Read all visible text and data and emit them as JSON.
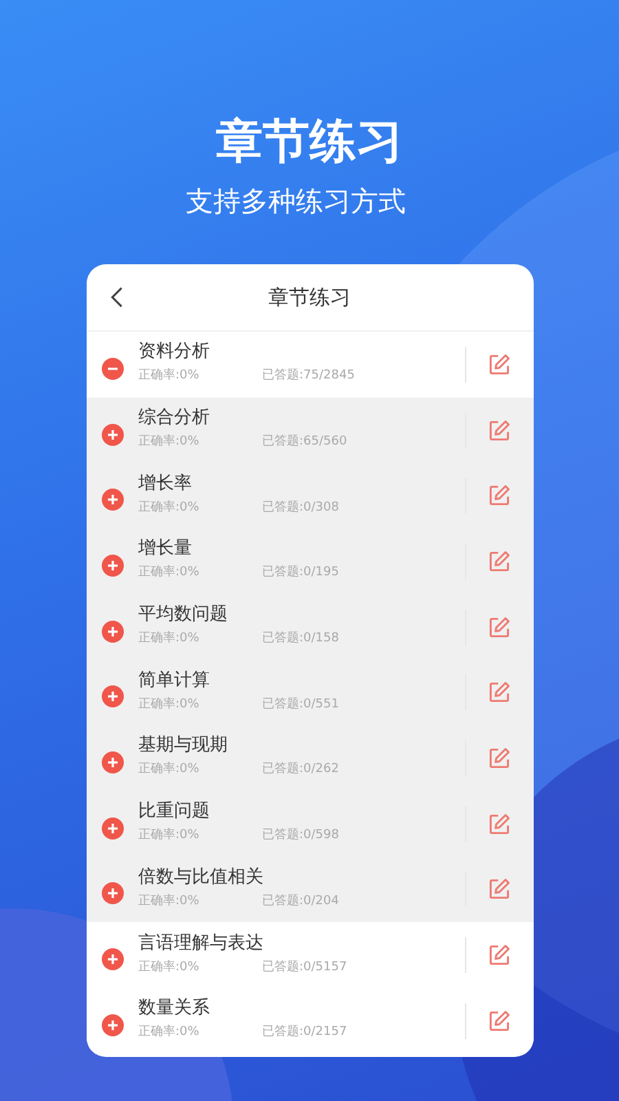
{
  "headline": "章节练习",
  "subheadline": "支持多种练习方式",
  "screen": {
    "title": "章节练习"
  },
  "chapters": [
    {
      "name": "资料分析",
      "accuracy": "正确率:0%",
      "answered": "已答题:75/2845",
      "expanded": true,
      "children": [
        {
          "name": "综合分析",
          "accuracy": "正确率:0%",
          "answered": "已答题:65/560",
          "expanded": false
        },
        {
          "name": "增长率",
          "accuracy": "正确率:0%",
          "answered": "已答题:0/308",
          "expanded": false
        },
        {
          "name": "增长量",
          "accuracy": "正确率:0%",
          "answered": "已答题:0/195",
          "expanded": false
        },
        {
          "name": "平均数问题",
          "accuracy": "正确率:0%",
          "answered": "已答题:0/158",
          "expanded": false
        },
        {
          "name": "简单计算",
          "accuracy": "正确率:0%",
          "answered": "已答题:0/551",
          "expanded": false
        },
        {
          "name": "基期与现期",
          "accuracy": "正确率:0%",
          "answered": "已答题:0/262",
          "expanded": false
        },
        {
          "name": "比重问题",
          "accuracy": "正确率:0%",
          "answered": "已答题:0/598",
          "expanded": false
        },
        {
          "name": "倍数与比值相关",
          "accuracy": "正确率:0%",
          "answered": "已答题:0/204",
          "expanded": false
        }
      ]
    },
    {
      "name": "言语理解与表达",
      "accuracy": "正确率:0%",
      "answered": "已答题:0/5157",
      "expanded": false
    },
    {
      "name": "数量关系",
      "accuracy": "正确率:0%",
      "answered": "已答题:0/2157",
      "expanded": false
    }
  ]
}
